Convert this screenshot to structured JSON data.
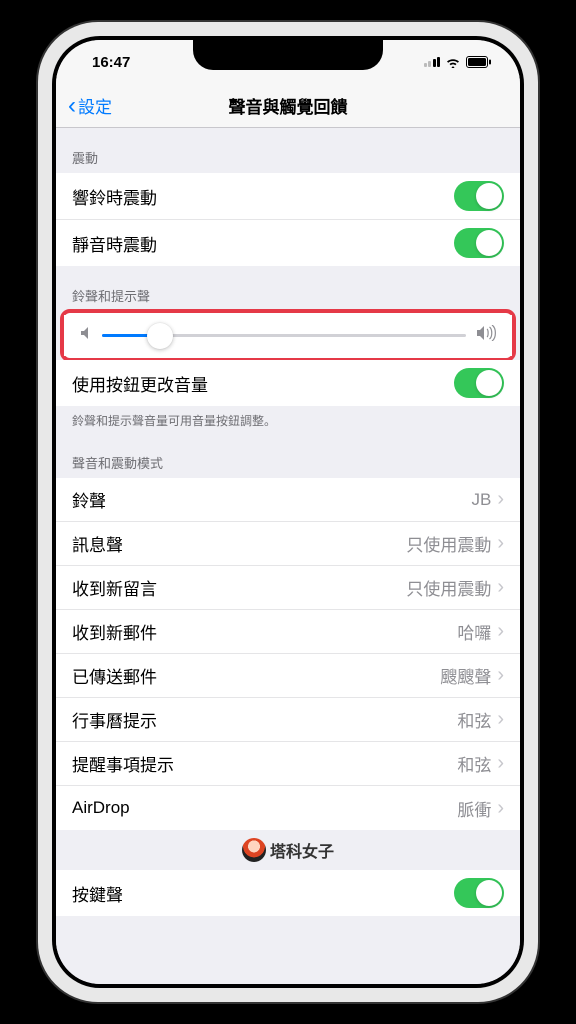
{
  "status": {
    "time": "16:47"
  },
  "nav": {
    "back_label": "設定",
    "title": "聲音與觸覺回饋"
  },
  "section_vibration": {
    "header": "震動",
    "ring_vibrate_label": "響鈴時震動",
    "ring_vibrate_on": true,
    "silent_vibrate_label": "靜音時震動",
    "silent_vibrate_on": true
  },
  "section_ringer": {
    "header": "鈴聲和提示聲",
    "slider_value": 0.16,
    "buttons_label": "使用按鈕更改音量",
    "buttons_on": true,
    "footer": "鈴聲和提示聲音量可用音量按鈕調整。"
  },
  "section_sounds": {
    "header": "聲音和震動模式",
    "items": [
      {
        "label": "鈴聲",
        "value": "JB"
      },
      {
        "label": "訊息聲",
        "value": "只使用震動"
      },
      {
        "label": "收到新留言",
        "value": "只使用震動"
      },
      {
        "label": "收到新郵件",
        "value": "哈囉"
      },
      {
        "label": "已傳送郵件",
        "value": "颼颼聲"
      },
      {
        "label": "行事曆提示",
        "value": "和弦"
      },
      {
        "label": "提醒事項提示",
        "value": "和弦"
      },
      {
        "label": "AirDrop",
        "value": "脈衝"
      }
    ]
  },
  "section_keyboard": {
    "keyboard_clicks_label": "按鍵聲",
    "keyboard_clicks_on": true
  },
  "watermark_text": "塔科女子"
}
